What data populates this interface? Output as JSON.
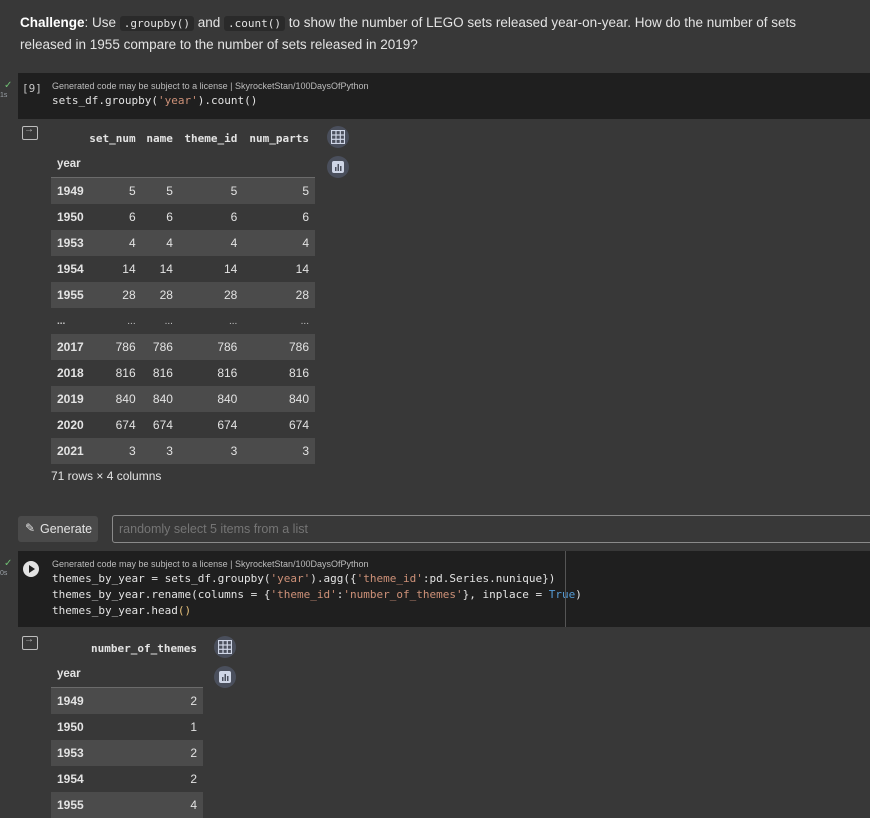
{
  "markdown": {
    "challenge_label": "Challenge",
    "text_1": ": Use ",
    "code_1": ".groupby()",
    "text_2": " and ",
    "code_2": ".count()",
    "text_3": " to show the number of LEGO sets released year-on-year. How do the number of sets released in 1955 compare to the number of sets released in 2019?"
  },
  "cell1": {
    "status": "✓",
    "exec_time": "1s",
    "exec_count": "[9]",
    "license": "Generated code may be subject to a license | SkyrocketStan/100DaysOfPython",
    "code_a": "sets_df.groupby(",
    "code_str": "'year'",
    "code_b": ").count()"
  },
  "table1": {
    "columns": [
      "set_num",
      "name",
      "theme_id",
      "num_parts"
    ],
    "index_name": "year",
    "rows": [
      [
        "1949",
        "5",
        "5",
        "5",
        "5"
      ],
      [
        "1950",
        "6",
        "6",
        "6",
        "6"
      ],
      [
        "1953",
        "4",
        "4",
        "4",
        "4"
      ],
      [
        "1954",
        "14",
        "14",
        "14",
        "14"
      ],
      [
        "1955",
        "28",
        "28",
        "28",
        "28"
      ],
      [
        "...",
        "...",
        "...",
        "...",
        "..."
      ],
      [
        "2017",
        "786",
        "786",
        "786",
        "786"
      ],
      [
        "2018",
        "816",
        "816",
        "816",
        "816"
      ],
      [
        "2019",
        "840",
        "840",
        "840",
        "840"
      ],
      [
        "2020",
        "674",
        "674",
        "674",
        "674"
      ],
      [
        "2021",
        "3",
        "3",
        "3",
        "3"
      ]
    ],
    "shape_info": "71 rows × 4 columns"
  },
  "generate": {
    "button_label": "Generate",
    "placeholder": "randomly select 5 items from a list"
  },
  "cell2": {
    "status": "✓",
    "exec_time": "0s",
    "license": "Generated code may be subject to a license | SkyrocketStan/100DaysOfPython",
    "l1_a": "themes_by_year = sets_df.groupby(",
    "l1_s1": "'year'",
    "l1_b": ").agg({",
    "l1_s2": "'theme_id'",
    "l1_c": ":pd.Series.nunique})",
    "l2_a": "themes_by_year.rename(columns = {",
    "l2_s1": "'theme_id'",
    "l2_b": ":",
    "l2_s2": "'number_of_themes'",
    "l2_c": "}, inplace = ",
    "l2_kw": "True",
    "l2_d": ")",
    "l3_a": "themes_by_year.head",
    "l3_p": "()"
  },
  "table2": {
    "columns": [
      "number_of_themes"
    ],
    "index_name": "year",
    "rows": [
      [
        "1949",
        "2"
      ],
      [
        "1950",
        "1"
      ],
      [
        "1953",
        "2"
      ],
      [
        "1954",
        "2"
      ],
      [
        "1955",
        "4"
      ]
    ]
  },
  "icons": {
    "table_view": "table-icon",
    "chart_suggest": "chart-icon",
    "output_toggle": "output-toggle-icon",
    "run": "play-icon",
    "generate": "magic-wand-icon"
  }
}
